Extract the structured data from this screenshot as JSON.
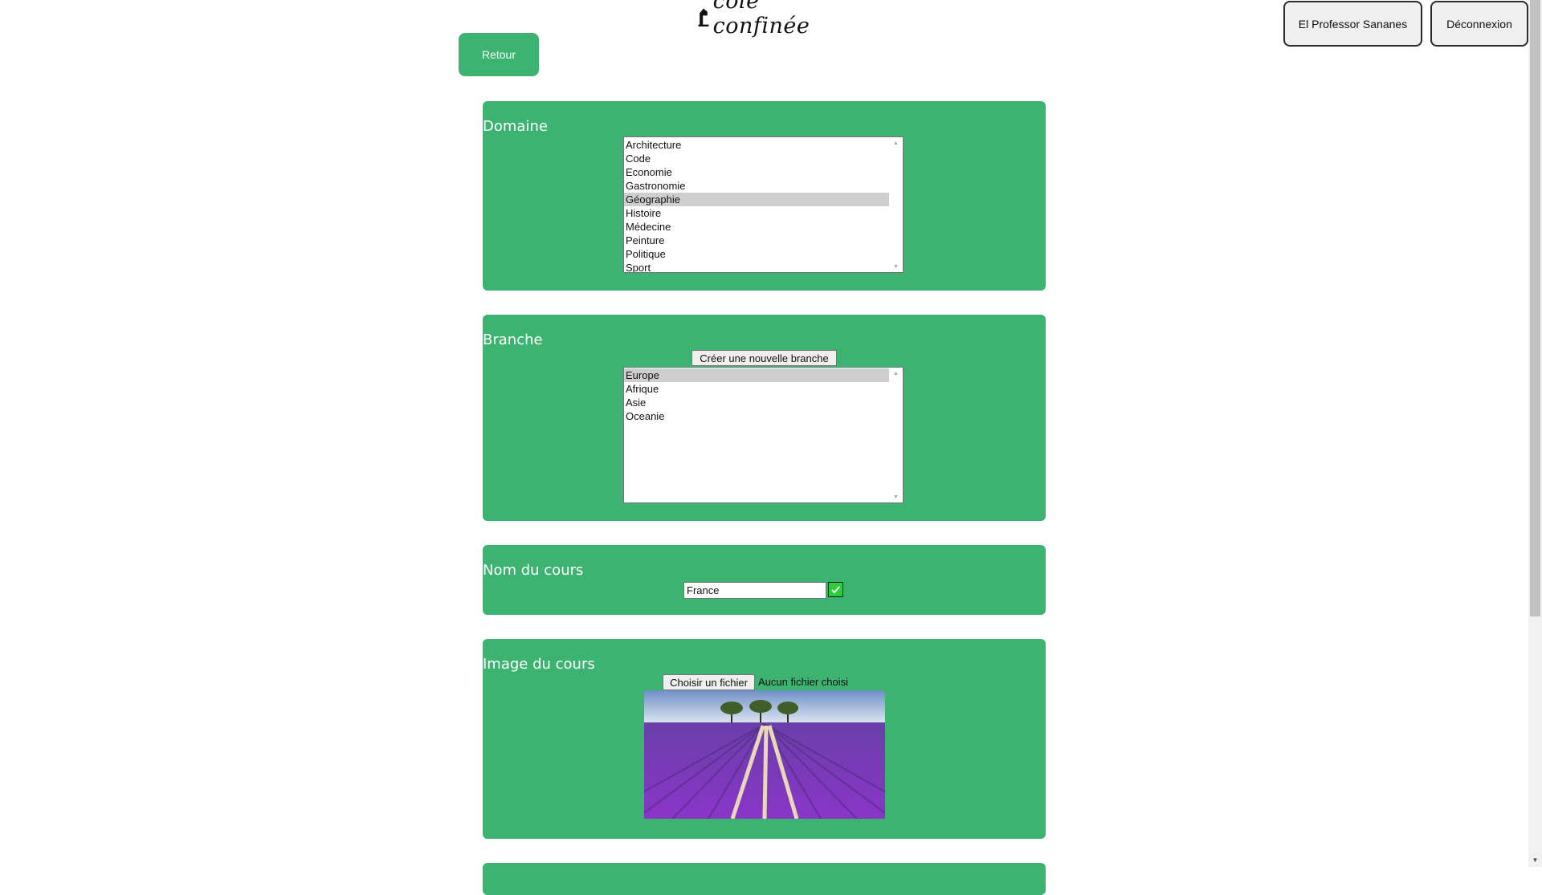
{
  "header": {
    "logo_text": "cole confinée",
    "user_button": "El Professor Sananes",
    "logout_button": "Déconnexion",
    "back_button": "Retour"
  },
  "domaine": {
    "title": "Domaine",
    "options": [
      "Architecture",
      "Code",
      "Economie",
      "Gastronomie",
      "Géographie",
      "Histoire",
      "Médecine",
      "Peinture",
      "Politique",
      "Sport"
    ],
    "selected": "Géographie"
  },
  "branche": {
    "title": "Branche",
    "create_button": "Créer une nouvelle branche",
    "options": [
      "Europe",
      "Afrique",
      "Asie",
      "Oceanie"
    ],
    "selected": "Europe"
  },
  "nom_cours": {
    "title": "Nom du cours",
    "value": "France"
  },
  "image_cours": {
    "title": "Image du cours",
    "file_button": "Choisir un fichier",
    "file_status": "Aucun fichier choisi"
  },
  "colors": {
    "accent": "#3cb371",
    "check": "#2ecc40"
  },
  "icons": [
    "school-logo-icon",
    "check-icon",
    "scroll-up-arrow-icon",
    "scroll-down-arrow-icon",
    "lavender-field-image"
  ]
}
